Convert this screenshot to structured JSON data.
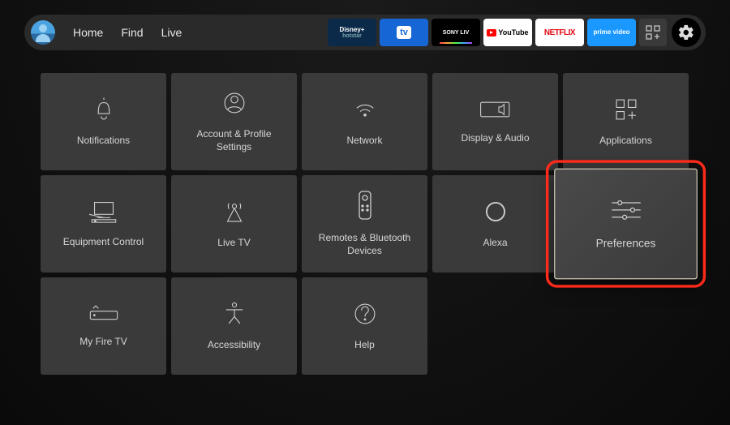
{
  "nav": {
    "home": "Home",
    "find": "Find",
    "live": "Live"
  },
  "apps": {
    "disney_line1": "Disney+",
    "disney_line2": "hotstar",
    "tv": "tv",
    "sony": "SONY LIV",
    "youtube": "YouTube",
    "netflix": "NETFLIX",
    "primevideo_line1": "prime video"
  },
  "settings_grid": {
    "notifications": "Notifications",
    "account": "Account & Profile Settings",
    "network": "Network",
    "display_audio": "Display & Audio",
    "applications": "Applications",
    "equipment": "Equipment Control",
    "live_tv": "Live TV",
    "remotes": "Remotes & Bluetooth Devices",
    "alexa": "Alexa",
    "preferences": "Preferences",
    "my_fire_tv": "My Fire TV",
    "accessibility": "Accessibility",
    "help": "Help"
  }
}
